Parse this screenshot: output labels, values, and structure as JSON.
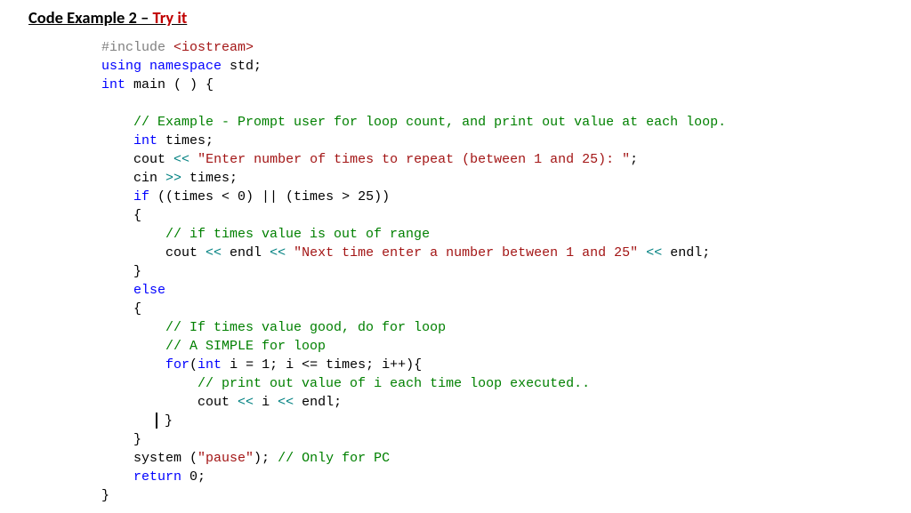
{
  "heading": {
    "prefix": "Code Example 2 – ",
    "try_it": "Try it"
  },
  "code": {
    "include_hash": "#include",
    "include_header": " <iostream>",
    "using1": "using",
    "using2": " namespace",
    "using3": " std;",
    "int": "int",
    "main_sig": " main ( ) {",
    "c1": "// Example - Prompt user for loop count, and print out value at each loop.",
    "int2": "int",
    "times_decl": " times;",
    "cout1a": "cout ",
    "op_ll": "<<",
    "sp": " ",
    "str1": "\"Enter number of times to repeat (between 1 and 25): \"",
    "semi": ";",
    "cin1a": "cin ",
    "op_rr": ">>",
    "times_use": " times;",
    "if_kw": "if",
    "if_cond": " ((times < 0) || (times > 25))",
    "brace_o": "{",
    "c2": "// if times value is out of range",
    "cout2a": "cout ",
    "endl1": " endl ",
    "str2": "\"Next time enter a number between 1 and 25\"",
    "endl2": " endl;",
    "brace_c": "}",
    "else_kw": "else",
    "c3": "// If times value good, do for loop",
    "c4": "// A SIMPLE for loop",
    "for_kw": "for",
    "for_paren_int": "int",
    "for_rest": " i = 1; i <= times; i++){",
    "for_open": "(",
    "c5": "// print out value of i each time loop executed..",
    "cout3a": "cout ",
    "i_var": " i ",
    "endl3": " endl;",
    "sys1": "system (",
    "str3": "\"pause\"",
    "sys2": "); ",
    "c6": "// Only for PC",
    "return_kw": "return",
    "return_val": " 0;"
  }
}
